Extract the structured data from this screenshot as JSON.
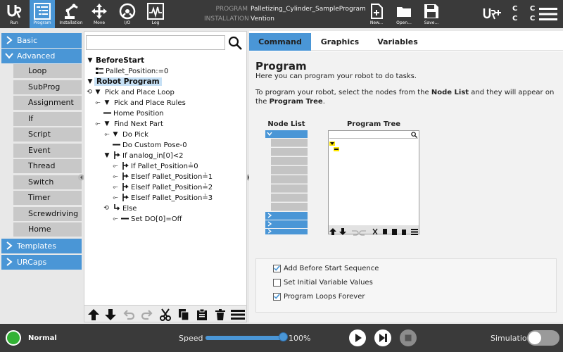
{
  "header": {
    "nav": [
      {
        "label": "Run",
        "icon": "ur-logo-icon"
      },
      {
        "label": "Program",
        "icon": "program-icon",
        "active": true
      },
      {
        "label": "Installation",
        "icon": "robot-arm-icon"
      },
      {
        "label": "Move",
        "icon": "move-arrows-icon"
      },
      {
        "label": "I/O",
        "icon": "io-icon"
      },
      {
        "label": "Log",
        "icon": "log-icon"
      }
    ],
    "program_key": "PROGRAM",
    "program_value": "Palletizing_Cylinder_SampleProgram",
    "installation_key": "INSTALLATION",
    "installation_value": "Vention",
    "file_actions": [
      {
        "label": "New...",
        "icon": "new-file-icon"
      },
      {
        "label": "Open...",
        "icon": "open-folder-icon"
      },
      {
        "label": "Save...",
        "icon": "save-icon"
      }
    ],
    "ccc_line1": "C C",
    "ccc_line2": "C C"
  },
  "leftnav": {
    "basic_label": "Basic",
    "advanced_label": "Advanced",
    "advanced_items": [
      "Loop",
      "SubProg",
      "Assignment",
      "If",
      "Script",
      "Event",
      "Thread",
      "Switch",
      "Timer",
      "Screwdriving",
      "Home"
    ],
    "templates_label": "Templates",
    "urcaps_label": "URCaps"
  },
  "tree": {
    "search_placeholder": "",
    "rows": [
      {
        "text": "BeforeStart"
      },
      {
        "text": "Pallet_Position:=0"
      },
      {
        "text": "Robot Program"
      },
      {
        "text": "Pick and Place Loop"
      },
      {
        "text": "Pick and Place Rules"
      },
      {
        "text": "Home Position"
      },
      {
        "text": "Find Next Part"
      },
      {
        "text": "Do Pick"
      },
      {
        "text": "Do Custom Pose-0"
      },
      {
        "text": "If analog_in[0]<2"
      },
      {
        "text": "If Pallet_Position≟0"
      },
      {
        "text": "ElseIf Pallet_Position≟1"
      },
      {
        "text": "ElseIf Pallet_Position≟2"
      },
      {
        "text": "ElseIf Pallet_Position≟3"
      },
      {
        "text": "Else"
      },
      {
        "text": "Set DO[0]=Off"
      }
    ]
  },
  "right": {
    "tabs": [
      "Command",
      "Graphics",
      "Variables"
    ],
    "title": "Program",
    "subtitle": "Here you can program your robot to do tasks.",
    "desc_pre": "To program your robot, select the nodes from the ",
    "desc_node_list": "Node List",
    "desc_mid": " and they will appear on the ",
    "desc_program_tree": "Program Tree",
    "desc_post": ".",
    "node_list_title": "Node List",
    "program_tree_title": "Program Tree",
    "options": [
      {
        "label": "Add Before Start Sequence",
        "checked": true
      },
      {
        "label": "Set Initial Variable Values",
        "checked": false
      },
      {
        "label": "Program Loops Forever",
        "checked": true
      }
    ]
  },
  "footer": {
    "status": "Normal",
    "speed_label": "Speed",
    "speed_value": "100%",
    "speed_fraction": 1.0,
    "simulation_label": "Simulation",
    "simulation_on": false
  },
  "colors": {
    "accent": "#4a96d6",
    "header": "#3a3a3a",
    "status_ok": "#33b235",
    "selection": "#c6e0f5"
  }
}
